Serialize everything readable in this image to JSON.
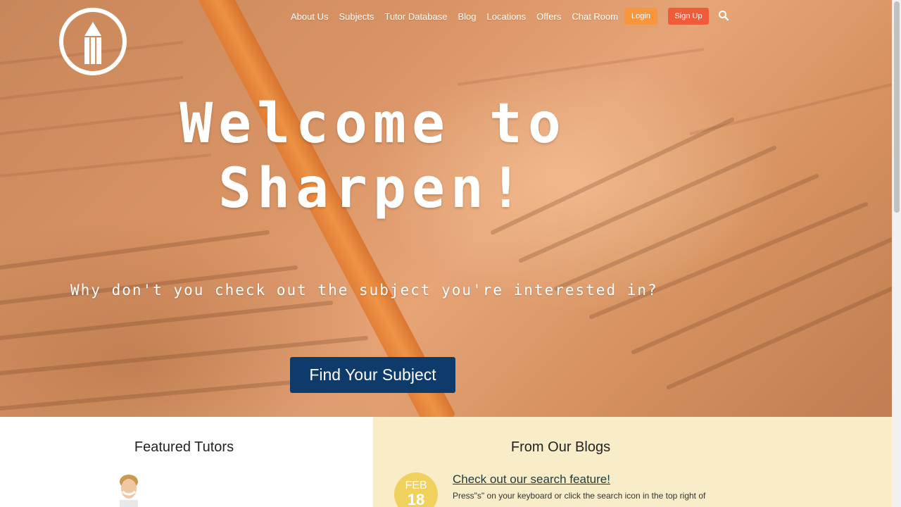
{
  "nav": {
    "links": [
      "About Us",
      "Subjects",
      "Tutor Database",
      "Blog",
      "Locations",
      "Offers",
      "Chat Room"
    ],
    "login_label": "Login",
    "signup_label": "Sign Up",
    "search_icon": "search-icon"
  },
  "hero": {
    "title_line1": "Welcome to",
    "title_line2": "Sharpen!",
    "subtitle": "Why don't you check out the subject you're interested in?",
    "cta_label": "Find Your Subject"
  },
  "featured": {
    "heading": "Featured Tutors"
  },
  "blogs": {
    "heading": "From Our Blogs",
    "post": {
      "month": "FEB",
      "day": "18",
      "title": "Check out our search feature!",
      "excerpt": "Press\"s\" on your keyboard or click the search icon in the top right of"
    }
  },
  "colors": {
    "login": "#f7963d",
    "signup": "#f05b3a",
    "cta": "#0e3b6b",
    "blogs_bg": "#f8edc8",
    "date_badge": "#f1d15e"
  }
}
